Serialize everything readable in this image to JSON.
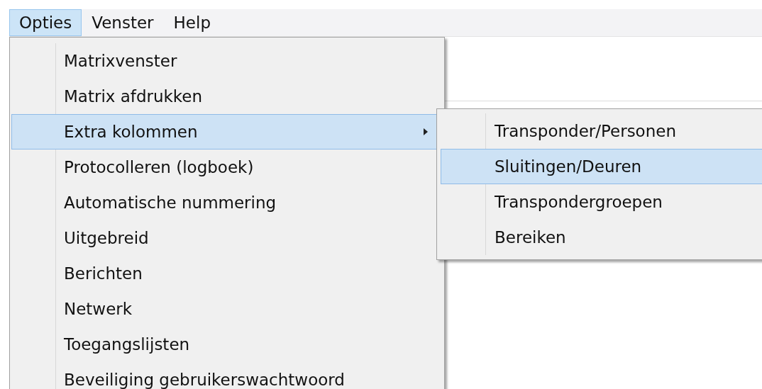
{
  "menubar": [
    {
      "label": "Opties",
      "selected": true
    },
    {
      "label": "Venster",
      "selected": false
    },
    {
      "label": "Help",
      "selected": false
    }
  ],
  "menu": {
    "items": [
      {
        "label": "Matrixvenster",
        "kind": "item",
        "selected": false
      },
      {
        "label": "Matrix afdrukken",
        "kind": "item",
        "selected": false
      },
      {
        "label": "Extra kolommen",
        "kind": "submenu",
        "selected": true
      },
      {
        "label": "Protocolleren (logboek)",
        "kind": "item",
        "selected": false
      },
      {
        "label": "Automatische nummering",
        "kind": "item",
        "selected": false
      },
      {
        "label": "Uitgebreid",
        "kind": "item",
        "selected": false
      },
      {
        "label": "Berichten",
        "kind": "item",
        "selected": false
      },
      {
        "label": "Netwerk",
        "kind": "item",
        "selected": false
      },
      {
        "label": "Toegangslijsten",
        "kind": "item",
        "selected": false
      },
      {
        "label": "Beveiliging gebruikerswachtwoord",
        "kind": "item",
        "selected": false
      }
    ]
  },
  "submenu": {
    "items": [
      {
        "label": "Transponder/Personen",
        "selected": false
      },
      {
        "label": "Sluitingen/Deuren",
        "selected": true
      },
      {
        "label": "Transpondergroepen",
        "selected": false
      },
      {
        "label": "Bereiken",
        "selected": false
      }
    ]
  }
}
